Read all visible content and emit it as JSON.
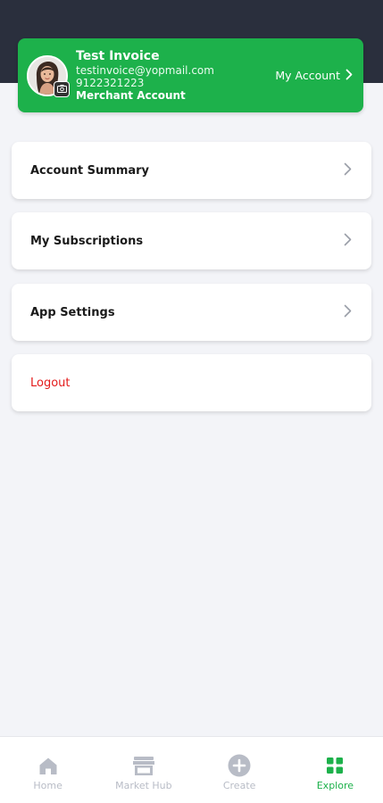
{
  "colors": {
    "brand_green": "#1db14b",
    "header_dark": "#2a2f3d",
    "logout_red": "#e41b1b",
    "nav_inactive": "#b8bcc6"
  },
  "profile": {
    "name": "Test Invoice",
    "email": "testinvoice@yopmail.com",
    "phone": "9122321223",
    "account_type": "Merchant Account",
    "my_account_label": "My Account",
    "avatar_icon": "avatar-photo",
    "camera_icon": "camera-icon"
  },
  "menu": {
    "items": [
      {
        "label": "Account Summary",
        "icon": "chevron-right-icon"
      },
      {
        "label": "My Subscriptions",
        "icon": "chevron-right-icon"
      },
      {
        "label": "App Settings",
        "icon": "chevron-right-icon"
      },
      {
        "label": "Logout"
      }
    ]
  },
  "bottom_nav": {
    "items": [
      {
        "label": "Home",
        "icon": "home-icon",
        "active": false
      },
      {
        "label": "Market Hub",
        "icon": "store-icon",
        "active": false
      },
      {
        "label": "Create",
        "icon": "plus-circle-icon",
        "active": false
      },
      {
        "label": "Explore",
        "icon": "grid-icon",
        "active": true
      }
    ]
  }
}
